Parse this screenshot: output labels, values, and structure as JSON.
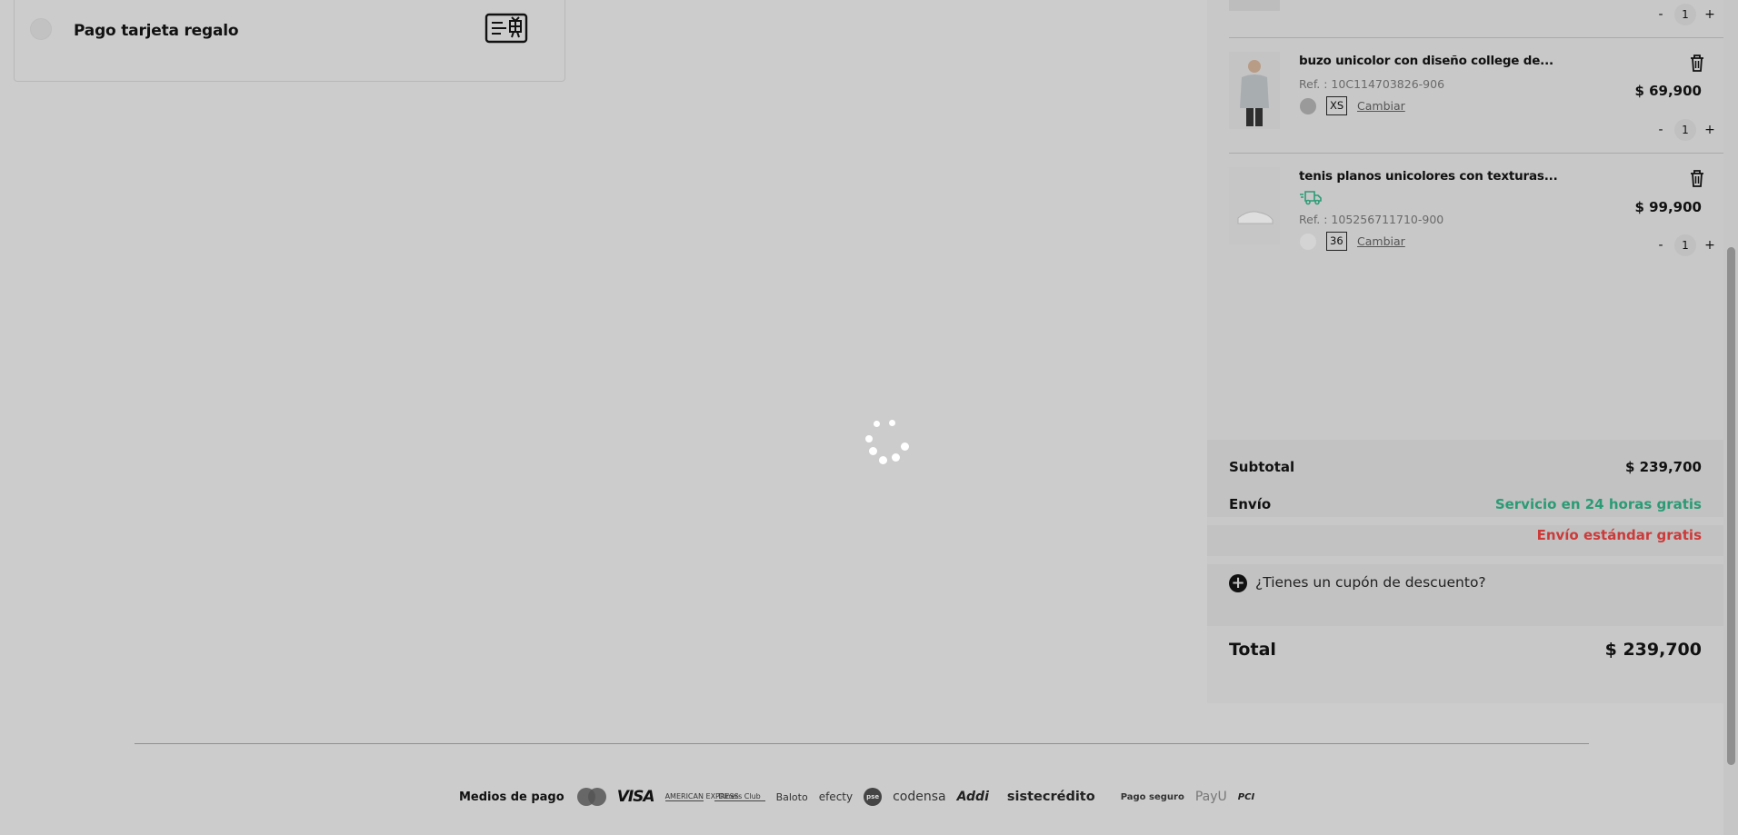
{
  "payment": {
    "gift_card_label": "Pago tarjeta regalo",
    "gift_card_icon": "gift-card-icon"
  },
  "loading": {
    "spinner_icon": "loading-spinner-icon"
  },
  "cart": {
    "partial_item": {
      "quantity": "1",
      "minus": "-",
      "plus": "+"
    },
    "items": [
      {
        "name": "buzo unicolor con diseño college de...",
        "ref": "Ref. : 10C114703826-906",
        "color": "#9a9a9a",
        "size": "XS",
        "change_label": "Cambiar",
        "price": "$ 69,900",
        "quantity": "1",
        "minus": "-",
        "plus": "+",
        "express": false
      },
      {
        "name": "tenis planos unicolores con texturas...",
        "ref": "Ref. : 105256711710-900",
        "color": "#d4d4d4",
        "size": "36",
        "change_label": "Cambiar",
        "price": "$ 99,900",
        "quantity": "1",
        "minus": "-",
        "plus": "+",
        "express": true
      }
    ]
  },
  "summary": {
    "subtotal_label": "Subtotal",
    "subtotal_value": "$ 239,700",
    "shipping_label": "Envío",
    "shipping_express": "Servicio en 24 horas gratis",
    "shipping_standard": "Envío estándar gratis",
    "coupon_label": "¿Tienes un cupón de descuento?",
    "total_label": "Total",
    "total_value": "$ 239,700"
  },
  "colors": {
    "accent_green": "#2b9b75",
    "accent_red": "#cc3a3a",
    "overlay_bg": "#cccccc"
  },
  "footer": {
    "payment_methods_label": "Medios de pago",
    "logos": [
      "MasterCard",
      "VISA",
      "AMERICAN EXPRESS",
      "Diners Club",
      "Baloto",
      "efecty",
      "pse",
      "codensa",
      "Addi",
      "sistecrédito"
    ],
    "secure_label": "Pago seguro",
    "secure_logos": [
      "PayU",
      "PCI"
    ]
  }
}
